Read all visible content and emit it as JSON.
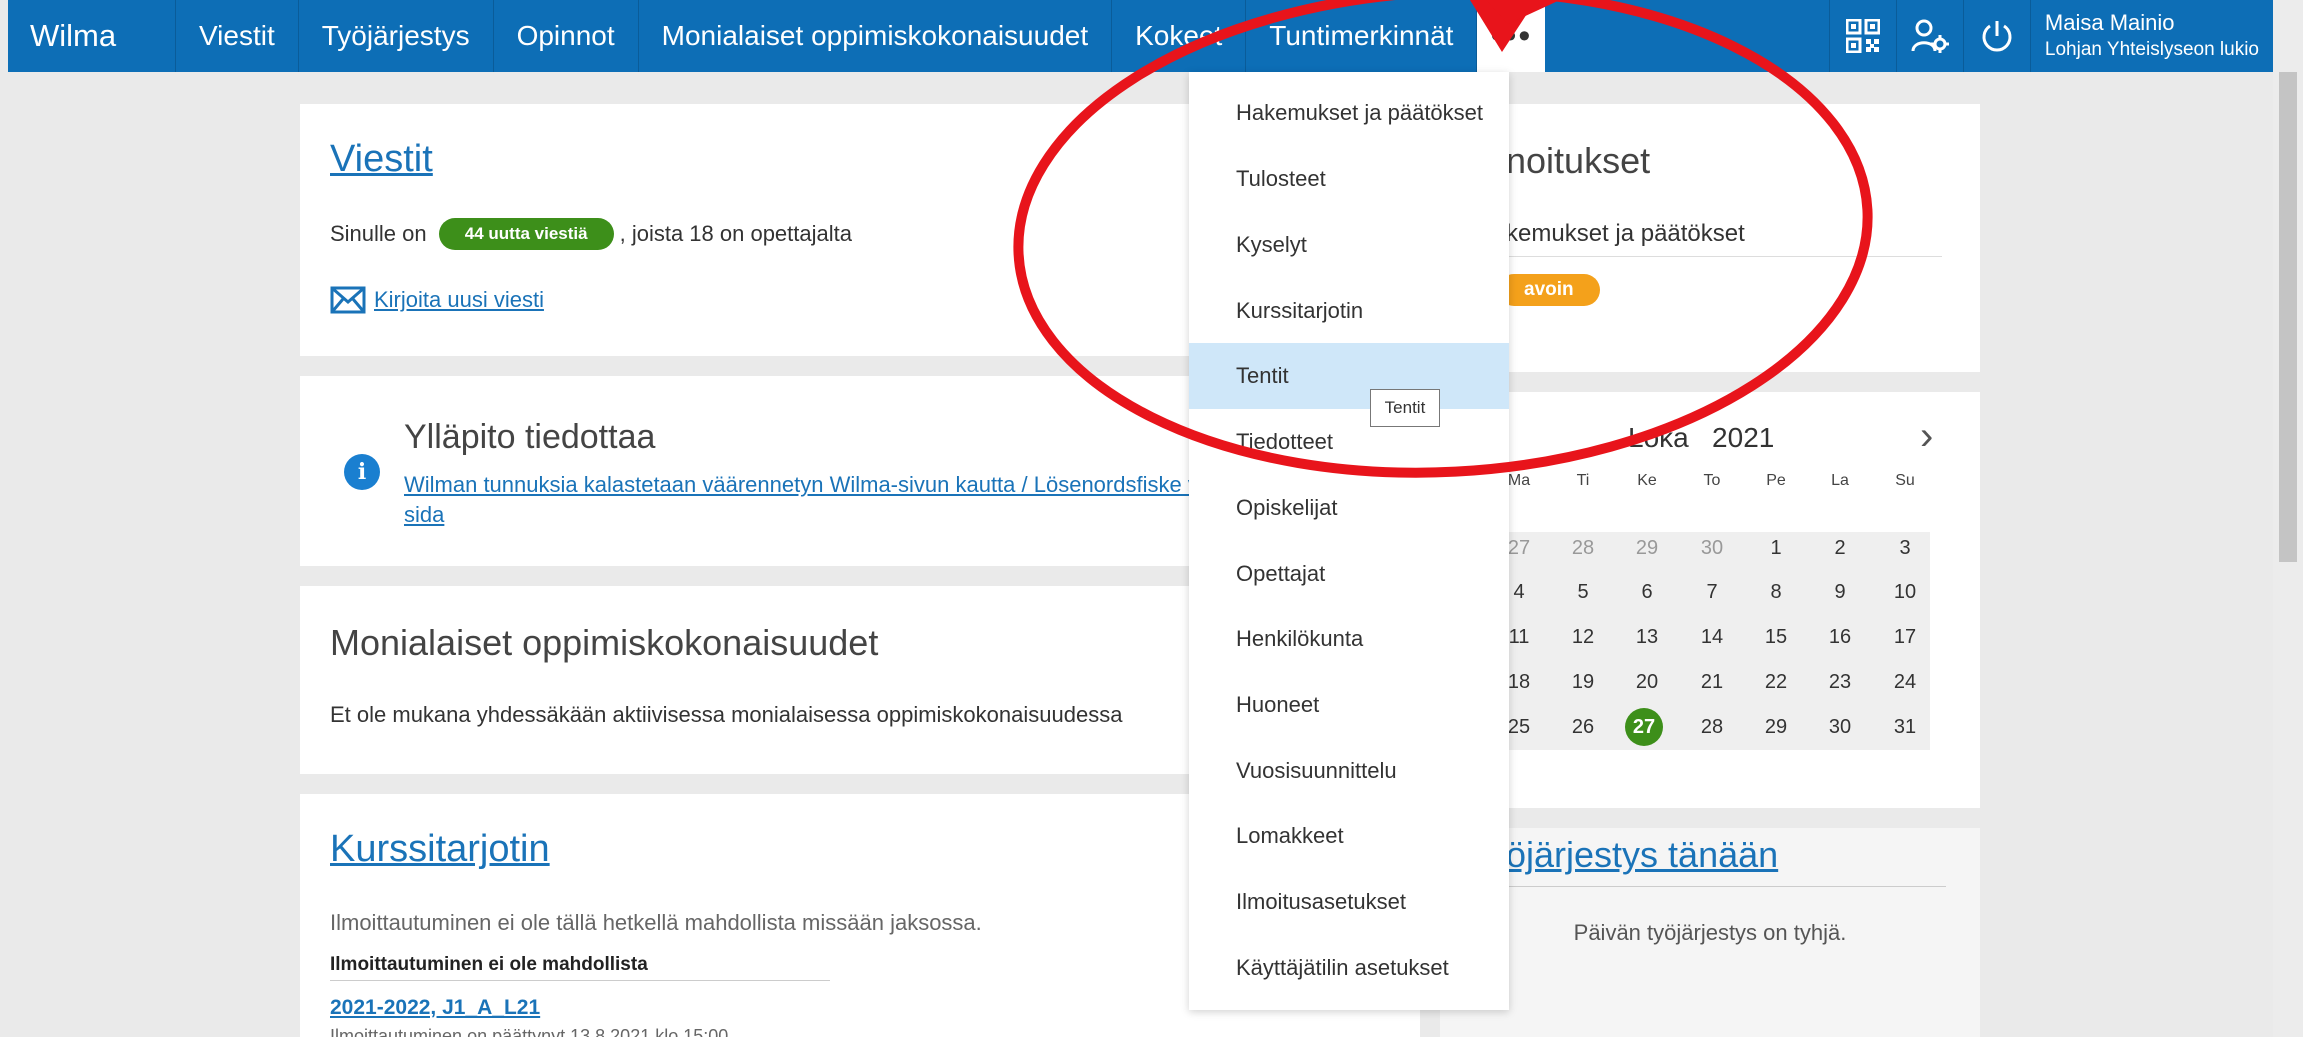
{
  "nav": {
    "brand": "Wilma",
    "items": [
      "Viestit",
      "Työjärjestys",
      "Opinnot",
      "Monialaiset oppimiskokonaisuudet",
      "Kokeet",
      "Tuntimerkinnät"
    ],
    "more_label": "•••",
    "user_name": "Maisa Mainio",
    "school": "Lohjan Yhteislyseon lukio"
  },
  "messages": {
    "title": "Viestit",
    "prefix": "Sinulle on",
    "badge": "44 uutta viestiä",
    "suffix": ", joista 18 on opettajalta",
    "compose": "Kirjoita uusi viesti"
  },
  "notice": {
    "title": "Ylläpito tiedottaa",
    "line1": "Wilman tunnuksia kalastetaan väärennetyn Wilma-sivun kautta / Lösenordsfiske v",
    "line2": "sida"
  },
  "monial": {
    "title": "Monialaiset oppimiskokonaisuudet",
    "text": "Et ole mukana yhdessäkään aktiivisessa monialaisessa oppimiskokonaisuudessa"
  },
  "kurssi": {
    "title": "Kurssitarjotin",
    "text": "Ilmoittautuminen ei ole tällä hetkellä mahdollista missään jaksossa.",
    "subhead": "Ilmoittautuminen ei ole mahdollista",
    "link": "2021-2022, J1_A_L21",
    "cut": "Ilmoittautuminen on päättynyt 13.8.2021 klo 15:00"
  },
  "ilmoitukset": {
    "title": "noitukset",
    "row": "kemukset ja päätökset",
    "badge": "avoin"
  },
  "calendar": {
    "month": "Loka   2021",
    "next": "›",
    "headers": [
      "Ma",
      "Ti",
      "Ke",
      "To",
      "Pe",
      "La",
      "Su"
    ],
    "weeks": [
      [
        "27",
        "28",
        "29",
        "30",
        "1",
        "2",
        "3"
      ],
      [
        "4",
        "5",
        "6",
        "7",
        "8",
        "9",
        "10"
      ],
      [
        "11",
        "12",
        "13",
        "14",
        "15",
        "16",
        "17"
      ],
      [
        "18",
        "19",
        "20",
        "21",
        "22",
        "23",
        "24"
      ],
      [
        "25",
        "26",
        "27",
        "28",
        "29",
        "30",
        "31"
      ]
    ],
    "today": "27"
  },
  "schedule": {
    "title": "öjärjestys tänään",
    "empty": "Päivän työjärjestys on tyhjä."
  },
  "dropdown": {
    "items": [
      "Hakemukset ja päätökset",
      "Tulosteet",
      "Kyselyt",
      "Kurssitarjotin",
      "Tentit",
      "Tiedotteet",
      "Opiskelijat",
      "Opettajat",
      "Henkilökunta",
      "Huoneet",
      "Vuosisuunnittelu",
      "Lomakkeet",
      "Ilmoitusasetukset",
      "Käyttäjätilin asetukset"
    ],
    "highlighted": 4,
    "tooltip": "Tentit"
  },
  "colors": {
    "nav": "#0d6eb6",
    "badge_green": "#3d8f1a",
    "badge_orange": "#f4a11b",
    "annotation": "#e8141b"
  }
}
